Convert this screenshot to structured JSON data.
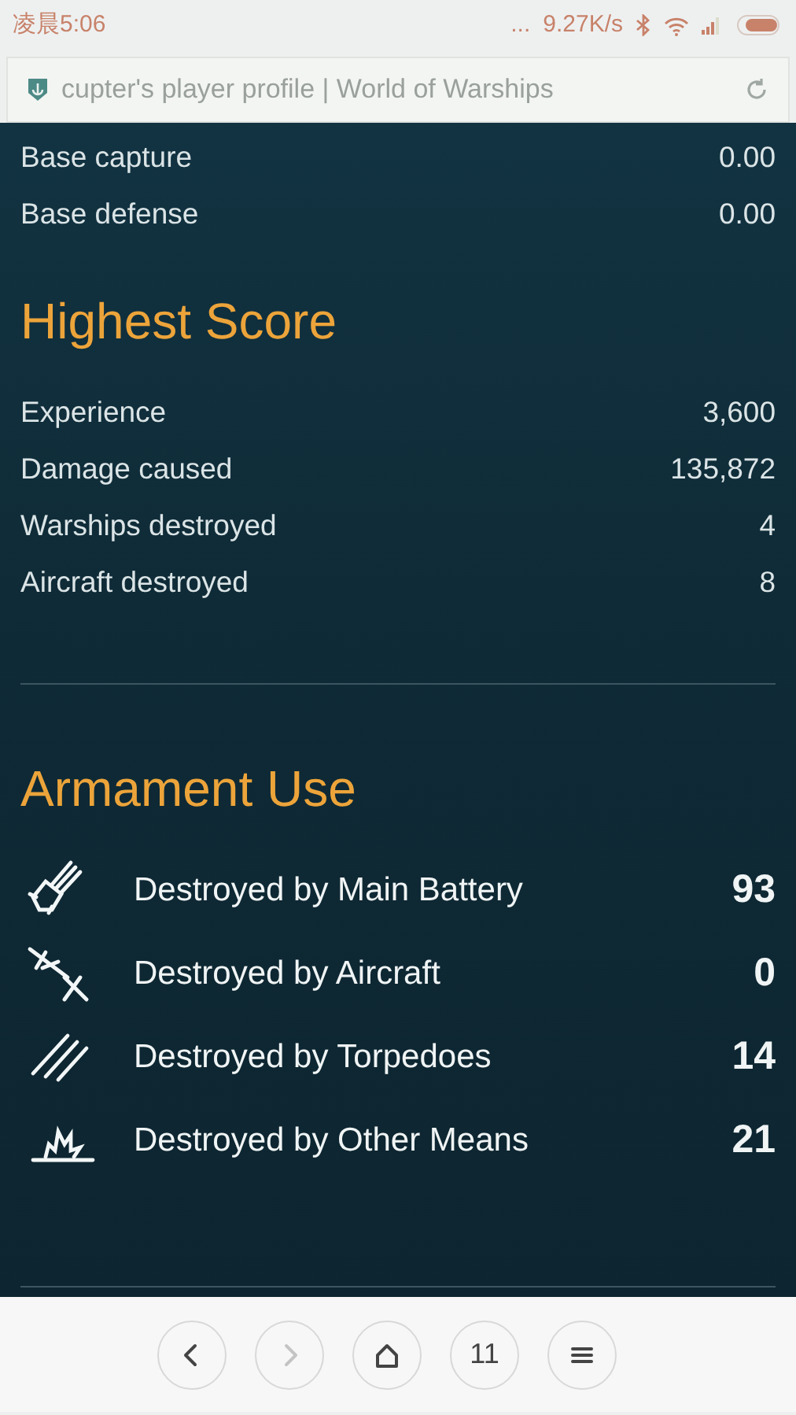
{
  "status_bar": {
    "time": "凌晨5:06",
    "dots": "...",
    "speed": "9.27K/s"
  },
  "address_bar": {
    "title": "cupter's player profile | World of Warships"
  },
  "top_stats": [
    {
      "label": "Base capture",
      "value": "0.00"
    },
    {
      "label": "Base defense",
      "value": "0.00"
    }
  ],
  "highest_score": {
    "title": "Highest Score",
    "rows": [
      {
        "label": "Experience",
        "value": "3,600"
      },
      {
        "label": "Damage caused",
        "value": "135,872"
      },
      {
        "label": "Warships destroyed",
        "value": "4"
      },
      {
        "label": "Aircraft destroyed",
        "value": "8"
      }
    ]
  },
  "armament_use": {
    "title": "Armament Use",
    "rows": [
      {
        "kind": "main_battery",
        "label": "Destroyed by Main Battery",
        "value": "93"
      },
      {
        "kind": "aircraft",
        "label": "Destroyed by Aircraft",
        "value": "0"
      },
      {
        "kind": "torpedoes",
        "label": "Destroyed by Torpedoes",
        "value": "14"
      },
      {
        "kind": "other",
        "label": "Destroyed by Other Means",
        "value": "21"
      }
    ]
  },
  "bottom_bar": [
    {
      "kind": "back",
      "disabled": false
    },
    {
      "kind": "forward",
      "disabled": true
    },
    {
      "kind": "home",
      "disabled": false
    },
    {
      "kind": "tabs",
      "label": "11",
      "disabled": false
    },
    {
      "kind": "menu",
      "disabled": false
    }
  ]
}
